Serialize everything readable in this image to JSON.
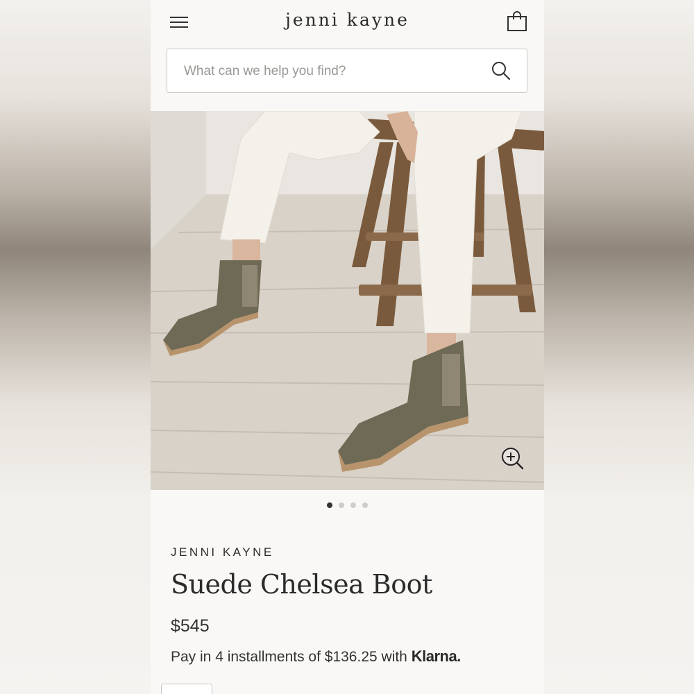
{
  "header": {
    "brand_logo": "jenni kayne",
    "menu_icon": "hamburger-menu-icon",
    "bag_icon": "shopping-bag-icon"
  },
  "search": {
    "placeholder": "What can we help you find?",
    "value": "",
    "icon": "search-icon"
  },
  "gallery": {
    "image_count": 4,
    "active_index": 0,
    "zoom_icon": "zoom-in-icon"
  },
  "product": {
    "brand": "JENNI KAYNE",
    "name": "Suede Chelsea Boot",
    "price": "$545",
    "installments_text": "Pay in 4 installments of $136.25 with",
    "installments_provider": "Klarna."
  },
  "colors": {
    "page_background": "#f9f8f6",
    "text": "#2b2b2b",
    "boot_suede": "#6f6a55",
    "trousers": "#f4f1ea",
    "stool_wood": "#7a5a3c"
  }
}
